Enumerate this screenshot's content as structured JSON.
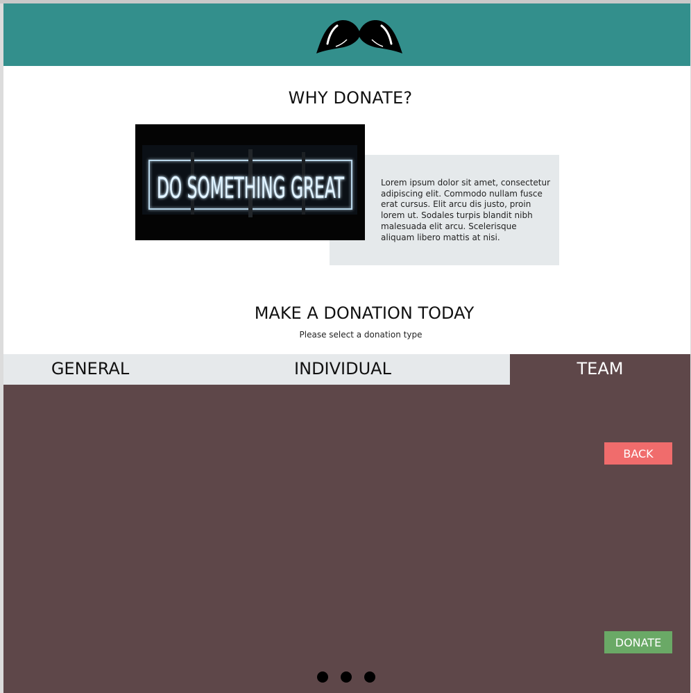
{
  "header": {
    "logo_icon": "mustache-icon",
    "background": "#338f8c"
  },
  "why": {
    "title": "WHY DONATE?",
    "image_text": "DO SOMETHING GREAT",
    "body": "Lorem ipsum dolor sit amet, consectetur adipiscing elit. Commodo nullam fusce erat cursus. Elit arcu dis justo, proin lorem ut. Sodales turpis blandit nibh malesuada elit arcu. Scelerisque aliquam libero mattis at nisi."
  },
  "donation": {
    "title": "MAKE A DONATION TODAY",
    "subtitle": "Please select a donation type",
    "tabs": [
      {
        "label": "GENERAL",
        "active": false
      },
      {
        "label": "INDIVIDUAL",
        "active": false
      },
      {
        "label": "TEAM",
        "active": true
      }
    ],
    "back_label": "BACK",
    "donate_label": "DONATE",
    "carousel_dots": 3
  },
  "colors": {
    "accent": "#338f8c",
    "panel": "#5e4749",
    "tab_bar": "#e6e9eb",
    "back_button": "#f06c6c",
    "donate_button": "#6aa966"
  }
}
